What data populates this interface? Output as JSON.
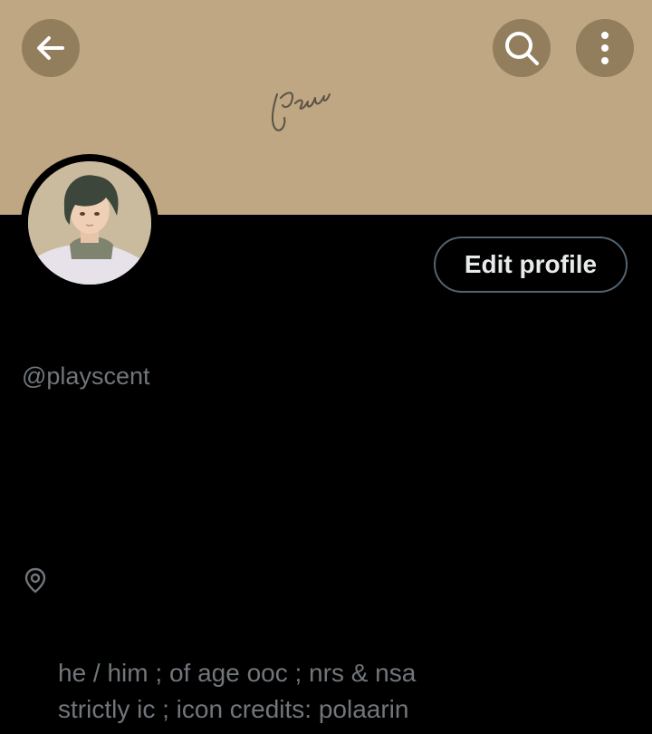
{
  "header": {
    "back_icon": "arrow-left-icon",
    "search_icon": "search-icon",
    "more_icon": "more-vertical-icon",
    "banner_color": "#bea782"
  },
  "profile": {
    "edit_button_label": "Edit profile",
    "handle": "@playscent",
    "location_icon": "location-pin-icon",
    "bio_lines": [
      "he / him ; of age ooc ; nrs & nsa",
      "strictly ic ; icon credits: polaarin"
    ]
  }
}
